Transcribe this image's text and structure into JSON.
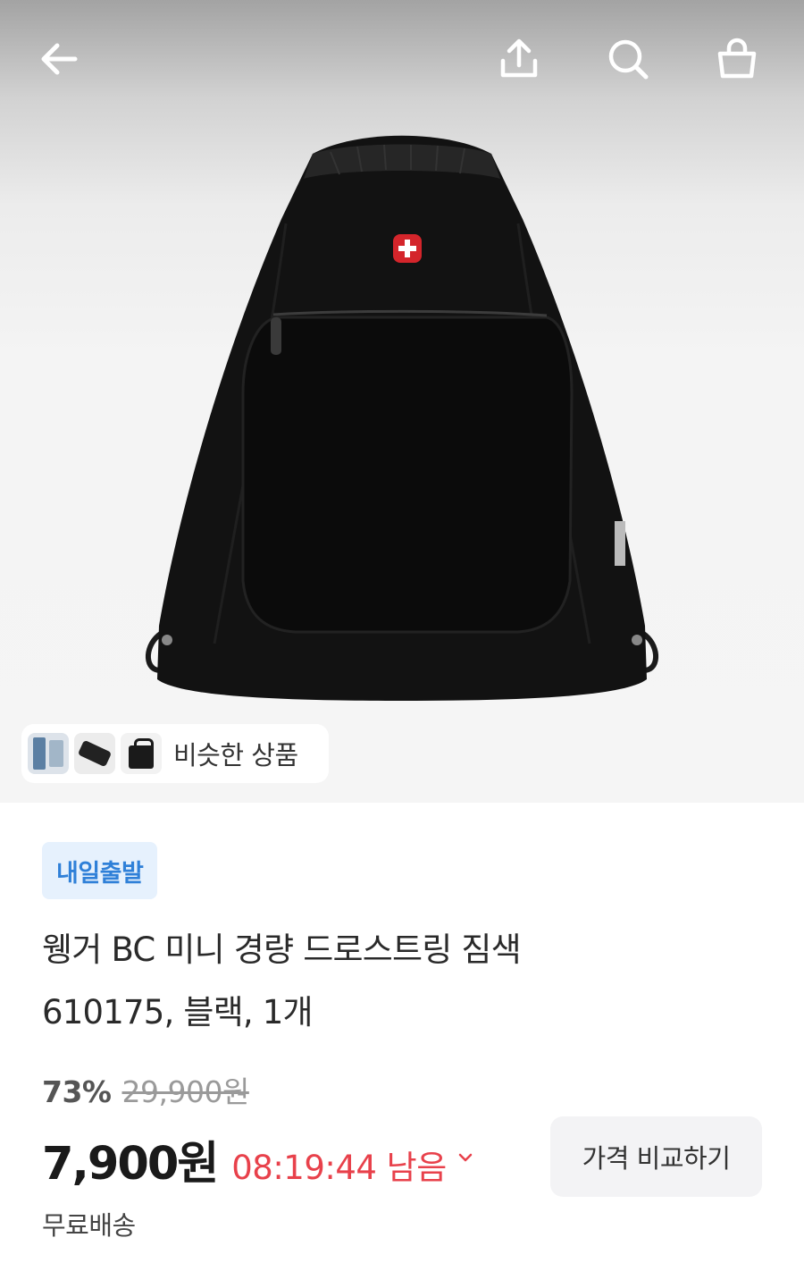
{
  "header": {
    "icons": [
      "back-arrow-icon",
      "share-icon",
      "search-icon",
      "shopping-bag-icon"
    ]
  },
  "hero": {
    "image": "black-drawstring-bag-image",
    "similar_label": "비슷한 상품"
  },
  "product": {
    "badge": "내일출발",
    "title_line1": "웽거 BC 미니 경량 드로스트링 짐색",
    "title_line2": "610175, 블랙, 1개",
    "discount_percent": "73%",
    "original_price": "29,900원",
    "price": "7,900원",
    "time_remaining": "08:19:44 남음",
    "compare_button": "가격 비교하기",
    "shipping": "무료배송"
  },
  "colors": {
    "badge_bg": "#e6f1fd",
    "badge_text": "#2f80d8",
    "timer_red": "#e8414b"
  }
}
